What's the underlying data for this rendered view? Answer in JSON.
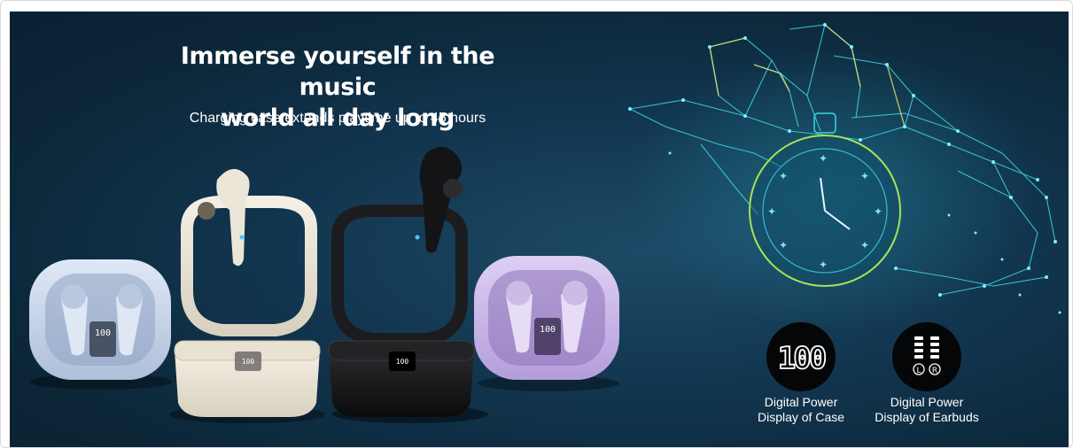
{
  "banner": {
    "headline_line1": "Immerse yourself in the music",
    "headline_line2": "world all day long",
    "subheadline": "Charging case extends playtime up to 45 hours"
  },
  "features": [
    {
      "badge_text": "100",
      "caption_line1": "Digital Power",
      "caption_line2": "Display of Case",
      "icon": "digital-100-display-icon"
    },
    {
      "badge_text_left": "L",
      "badge_text_right": "R",
      "caption_line1": "Digital Power",
      "caption_line2": "Display of Earbuds",
      "icon": "earbud-battery-bars-icon"
    }
  ],
  "products": {
    "case_display_text": "100",
    "colors": {
      "light_blue": "#c9d8ee",
      "beige": "#ece6d9",
      "black": "#151516",
      "purple": "#c9b6e8"
    }
  },
  "accent_colors": {
    "background": "#103049",
    "network_cyan": "#3fd6e6",
    "network_blue": "#3a7bd5"
  }
}
